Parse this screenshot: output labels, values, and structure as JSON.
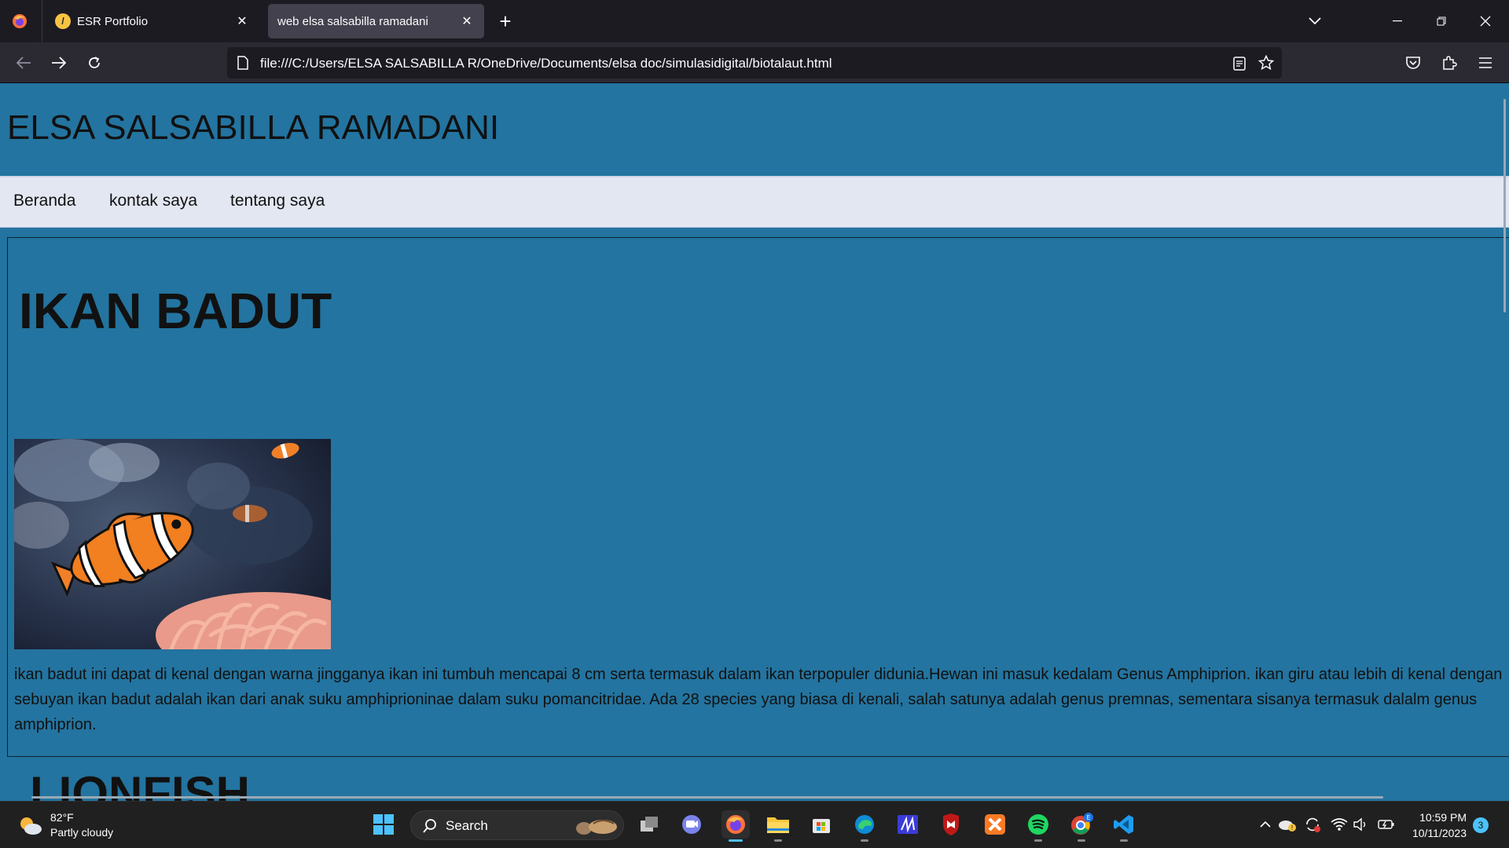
{
  "browser": {
    "tabs": [
      {
        "title": "ESR Portfolio",
        "favicon": "portfolio-favicon",
        "active": false
      },
      {
        "title": "web elsa salsabilla ramadani",
        "active": true
      }
    ],
    "url": "file:///C:/Users/ELSA SALSABILLA R/OneDrive/Documents/elsa doc/simulasidigital/biotalaut.html"
  },
  "page": {
    "site_title": "ELSA SALSABILLA RAMADANI",
    "nav": [
      "Beranda",
      "kontak saya",
      "tentang saya"
    ],
    "article": {
      "heading": "IKAN BADUT",
      "image_subject": "clownfish",
      "text": "ikan badut ini dapat di kenal dengan warna jingganya ikan ini tumbuh mencapai 8 cm serta termasuk dalam ikan terpopuler didunia.Hewan ini masuk kedalam Genus Amphiprion. ikan giru atau lebih di kenal dengan sebuyan ikan badut adalah ikan dari anak suku amphiprioninae dalam suku pomancitridae. Ada 28 species yang biasa di kenali, salah satunya adalah genus premnas, sementara sisanya termasuk dalalm genus amphiprion."
    },
    "next_heading": "LIONFISH",
    "colors": {
      "background": "#2374a0",
      "nav_bg": "#e3e7f2"
    }
  },
  "taskbar": {
    "weather_temp": "82°F",
    "weather_desc": "Partly cloudy",
    "search_label": "Search",
    "time": "10:59 PM",
    "date": "10/11/2023",
    "notification_count": "3",
    "chrome_badge": "E"
  }
}
